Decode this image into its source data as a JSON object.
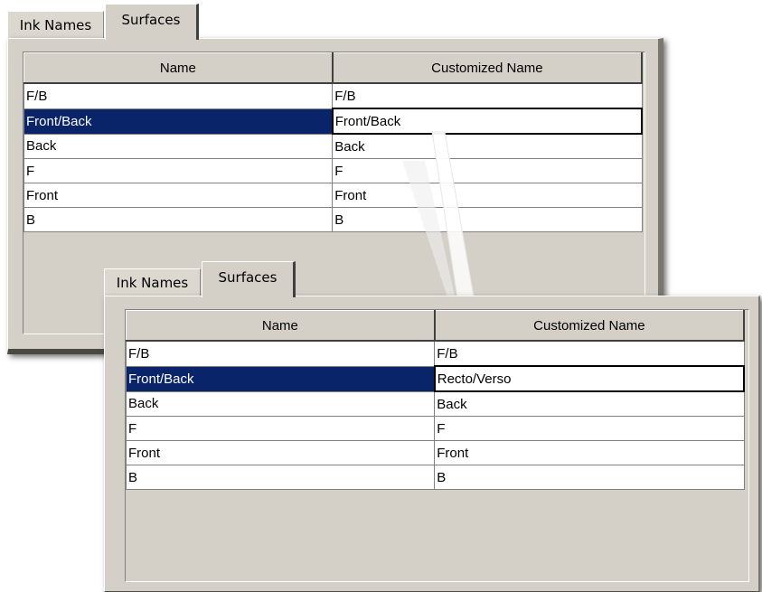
{
  "tabs": {
    "ink_names": "Ink Names",
    "surfaces": "Surfaces"
  },
  "columns": {
    "name": "Name",
    "customized_name": "Customized Name"
  },
  "before": {
    "rows": [
      {
        "name": "F/B",
        "custom": "F/B"
      },
      {
        "name": "Front/Back",
        "custom": "Front/Back"
      },
      {
        "name": "Back",
        "custom": "Back"
      },
      {
        "name": "F",
        "custom": "F"
      },
      {
        "name": "Front",
        "custom": "Front"
      },
      {
        "name": "B",
        "custom": "B"
      }
    ]
  },
  "after": {
    "rows": [
      {
        "name": "F/B",
        "custom": "F/B"
      },
      {
        "name": "Front/Back",
        "custom": "Recto/Verso"
      },
      {
        "name": "Back",
        "custom": "Back"
      },
      {
        "name": "F",
        "custom": "F"
      },
      {
        "name": "Front",
        "custom": "Front"
      },
      {
        "name": "B",
        "custom": "B"
      }
    ]
  },
  "colors": {
    "selection": "#0a246a",
    "panel": "#d4d0c8"
  }
}
